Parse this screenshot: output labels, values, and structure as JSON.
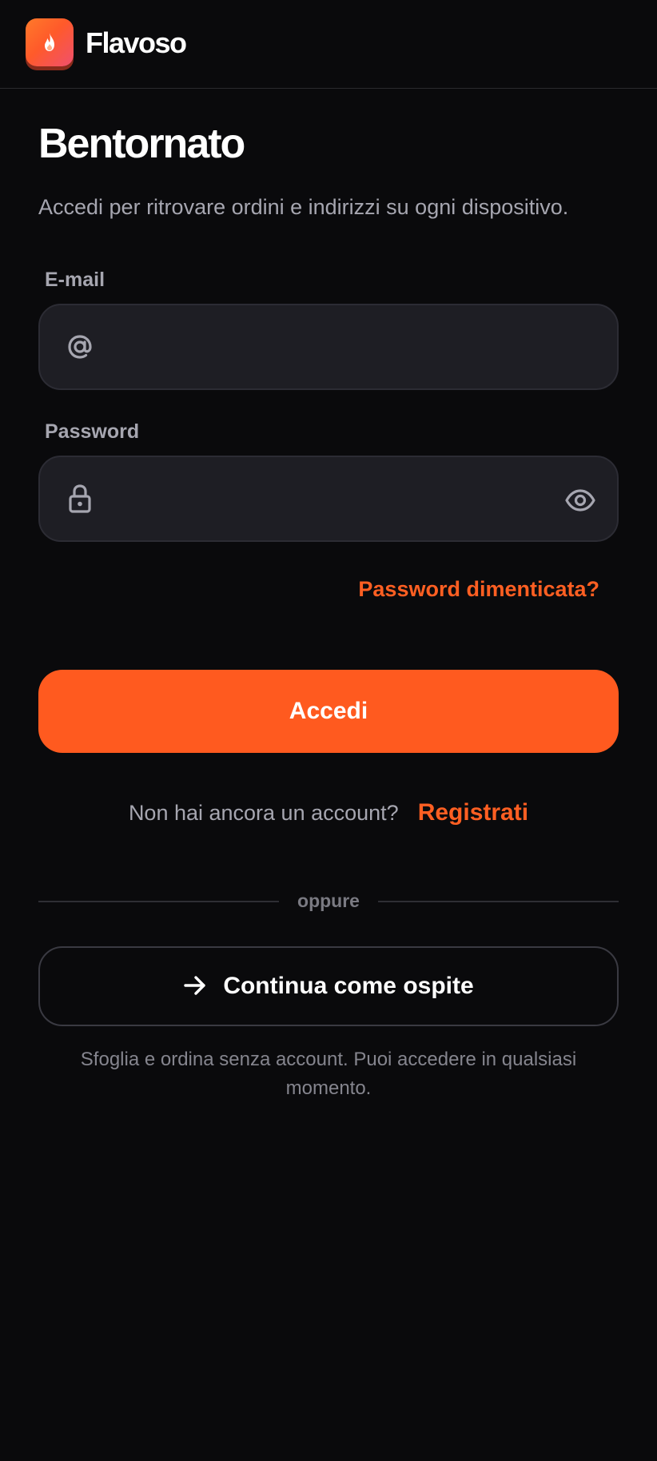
{
  "app": {
    "brand_name": "Flavoso",
    "logo_icon": "flame-icon",
    "accent_color": "#ff5a1f"
  },
  "login": {
    "title": "Bentornato",
    "subtitle": "Accedi per ritrovare ordini e indirizzi su ogni dispositivo.",
    "email": {
      "label": "E-mail",
      "value": "",
      "placeholder": "",
      "icon": "at-sign-icon"
    },
    "password": {
      "label": "Password",
      "value": "",
      "placeholder": "",
      "icon": "lock-icon",
      "toggle_icon": "eye-icon"
    },
    "forgot_link": "Password dimenticata?",
    "submit_label": "Accedi",
    "signup_question": "Non hai ancora un account?",
    "signup_link": "Registrati",
    "divider_text": "oppure",
    "guest_label": "Continua come ospite",
    "guest_icon": "arrow-right-icon",
    "guest_note": "Sfoglia e ordina senza account. Puoi accedere in qualsiasi momento."
  }
}
